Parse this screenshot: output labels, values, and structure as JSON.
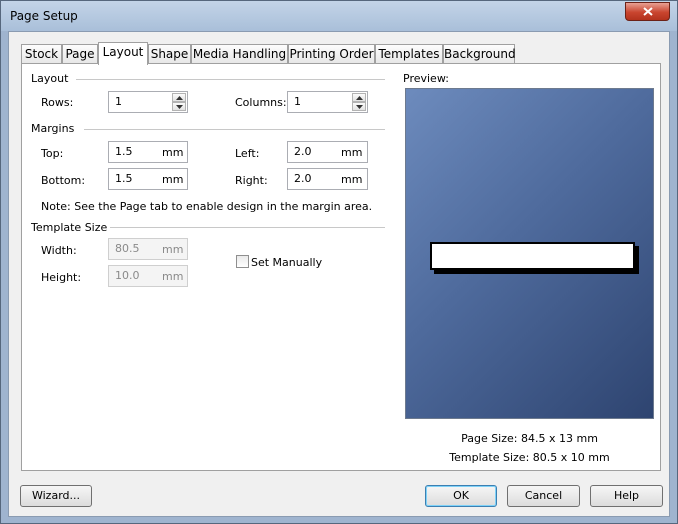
{
  "window": {
    "title": "Page Setup"
  },
  "tabs": [
    {
      "label": "Stock"
    },
    {
      "label": "Page"
    },
    {
      "label": "Layout"
    },
    {
      "label": "Shape"
    },
    {
      "label": "Media Handling"
    },
    {
      "label": "Printing Order"
    },
    {
      "label": "Templates"
    },
    {
      "label": "Background"
    }
  ],
  "active_tab": "Layout",
  "layout": {
    "section_label": "Layout",
    "rows_label": "Rows:",
    "rows_value": "1",
    "columns_label": "Columns:",
    "columns_value": "1"
  },
  "margins": {
    "section_label": "Margins",
    "top_label": "Top:",
    "top_value": "1.5",
    "left_label": "Left:",
    "left_value": "2.0",
    "bottom_label": "Bottom:",
    "bottom_value": "1.5",
    "right_label": "Right:",
    "right_value": "2.0",
    "unit": "mm",
    "note": "Note: See the Page tab to enable design in the margin area."
  },
  "template_size": {
    "section_label": "Template Size",
    "width_label": "Width:",
    "width_value": "80.5",
    "height_label": "Height:",
    "height_value": "10.0",
    "unit": "mm",
    "set_manually_label": "Set Manually",
    "set_manually_checked": false
  },
  "preview": {
    "label": "Preview:",
    "page_size_label": "Page Size:",
    "page_size_value": "84.5 x 13 mm",
    "template_size_label": "Template Size:",
    "template_size_value": "80.5 x 10 mm"
  },
  "buttons": {
    "wizard": "Wizard...",
    "ok": "OK",
    "cancel": "Cancel",
    "help": "Help"
  },
  "icons": {
    "close": "close-icon",
    "spin_up": "spin-up-icon",
    "spin_down": "spin-down-icon"
  },
  "colors": {
    "titlebar": "#a9bfd9",
    "close_button": "#c9452f",
    "preview_gradient_start": "#6d8bbd",
    "preview_gradient_end": "#2e4470",
    "default_button_border": "#3c7fb1"
  }
}
